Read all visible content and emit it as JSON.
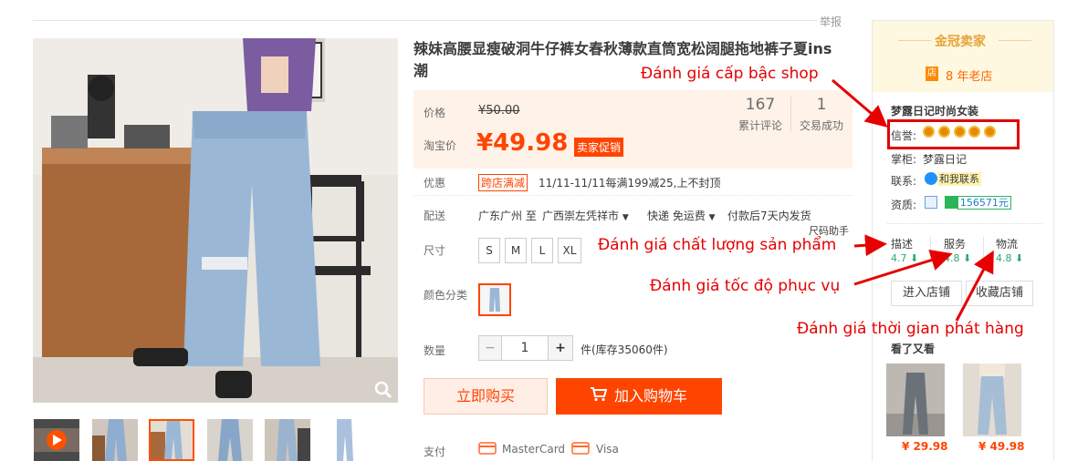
{
  "report_label": "举报",
  "title": "辣妹高腰显瘦破洞牛仔裤女春秋薄款直筒宽松阔腿拖地裤子夏ins潮",
  "price": {
    "label_price": "价格",
    "old_price": "¥50.00",
    "label_taobao": "淘宝价",
    "current_price": "¥49.98",
    "promo_tag": "卖家促销",
    "reviews_count": "167",
    "reviews_label": "累计评论",
    "deals_count": "1",
    "deals_label": "交易成功"
  },
  "discount": {
    "label": "优惠",
    "badge": "跨店满减",
    "text": "11/11-11/11每满199减25,上不封顶"
  },
  "shipping": {
    "label": "配送",
    "from": "广东广州 至",
    "to": "广西崇左凭祥市",
    "express": "快递 免运费",
    "delivery": "付款后7天内发货"
  },
  "size": {
    "label": "尺寸",
    "helper": "尺码助手",
    "options": [
      "S",
      "M",
      "L",
      "XL"
    ]
  },
  "color": {
    "label": "颜色分类"
  },
  "quantity": {
    "label": "数量",
    "minus": "−",
    "value": "1",
    "plus": "+",
    "stock": "件(库存35060件)"
  },
  "actions": {
    "buy_now": "立即购买",
    "add_to_cart": "加入购物车"
  },
  "payment": {
    "label": "支付",
    "methods": [
      "MasterCard",
      "Visa"
    ]
  },
  "seller": {
    "crown_title": "金冠卖家",
    "year_badge": "店",
    "years": "8 年老店",
    "shop_name": "梦露日记时尚女装",
    "credit_label": "信誉:",
    "owner_label": "掌柜:",
    "owner": "梦露日记",
    "contact_label": "联系:",
    "contact": "和我联系",
    "qual_label": "资质:",
    "deposit": "156571元",
    "scores": [
      {
        "label": "描述",
        "value": "4.7"
      },
      {
        "label": "服务",
        "value": "4.8"
      },
      {
        "label": "物流",
        "value": "4.8"
      }
    ],
    "enter_shop": "进入店铺",
    "fav_shop": "收藏店铺",
    "also_viewed": "看了又看",
    "recs": [
      {
        "price": "¥ 29.98"
      },
      {
        "price": "¥ 49.98"
      }
    ]
  },
  "annotations": {
    "shop_rank": "Đánh giá cấp bậc shop",
    "product_quality": "Đánh giá chất lượng sản phẩm",
    "service_speed": "Đánh giá tốc độ phục vụ",
    "shipping_time": "Đánh giá thời gian phát hàng"
  },
  "colors": {
    "accent": "#ff4400",
    "annotation": "#e60000",
    "gold": "#e5a53b",
    "price_bg": "#fff2e8"
  }
}
